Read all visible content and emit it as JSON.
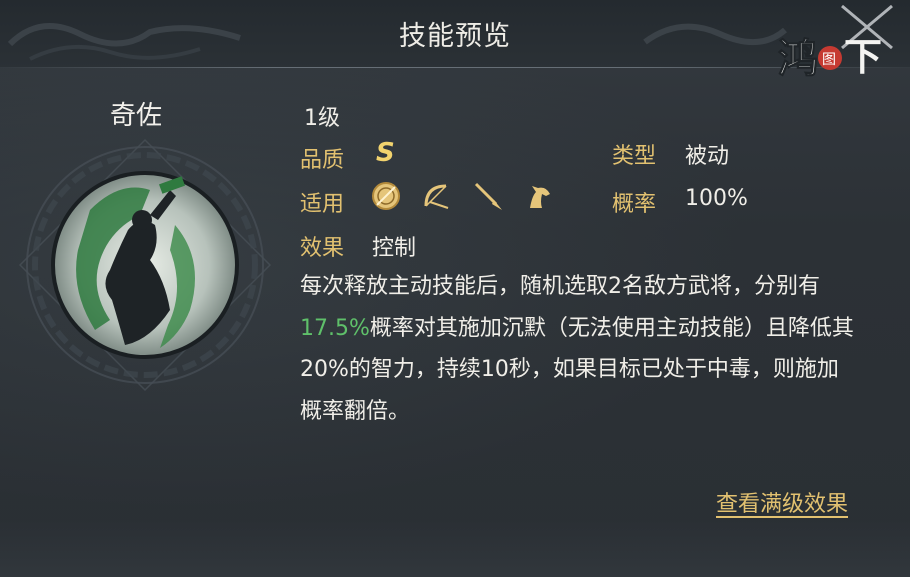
{
  "header": {
    "title": "技能预览",
    "logo_text": "鸿图之下"
  },
  "hero": {
    "name": "奇佐",
    "portrait": "silhouette-figure-icon"
  },
  "skill": {
    "level": "1级",
    "quality_label": "品质",
    "quality_value": "S",
    "type_label": "类型",
    "type_value": "被动",
    "applies_label": "适用",
    "applies_icons": [
      "shield-icon",
      "bow-icon",
      "spear-icon",
      "horse-icon"
    ],
    "rate_label": "概率",
    "rate_value": "100%",
    "effect_label": "效果",
    "effect_value": "控制",
    "desc_part1": "每次释放主动技能后，随机选取2名敌方武将，分别有",
    "desc_highlight": "17.5%",
    "desc_part2": "概率对其施加沉默（无法使用主动技能）且降低其20%的智力，持续10秒，如果目标已处于中毒，则施加概率翻倍。"
  },
  "actions": {
    "full_effect_link": "查看满级效果"
  },
  "colors": {
    "label_gold": "#e2c170",
    "highlight_green": "#5fc06a",
    "text_white": "#f0eee8",
    "background": "#2b3035"
  }
}
